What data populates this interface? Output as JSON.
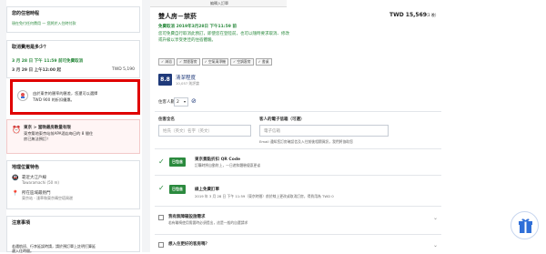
{
  "sidebar": {
    "your_stay": "您的住宿時程",
    "no_prepay": "現在免付任何費用 — 您將於入住時付款",
    "cancel_title": "取消費用是多少？",
    "cancel_free": "3 月 28 日 下午 11:59 前可免費取消",
    "cancel_after": "3 月 29 日 上午12:00 起",
    "cancel_fee": "TWD 5,190",
    "info_text_line1": "由於東京的匯率的匯差，您還可以選擇",
    "info_text_line2": "TWD 900 的折扣優惠。",
    "demand_title": "東京 > 當晚最房數量有限",
    "demand_text_line1": "東京築地東京站前APA酒店每日的 8 間住",
    "demand_text_line2": "房已無法預訂！",
    "location_title": "地理位置特色",
    "loc1_label": "靠近大江戶線",
    "loc1_sub": "Tawaramachi (50 m)",
    "loc2_label": "所在區域最熱門",
    "loc2_sub": "東京站 - 淺草和東京晴空塔周邊",
    "notes_title": "注意事項",
    "notes_text_line1": "若遇航班、行李延誤時請，請於預訂單上註明打算延",
    "notes_text_line2": "遲入住時間。"
  },
  "main": {
    "tab_label": "編輯入訂單",
    "room_title": "雙人房－禁菸",
    "price": "TWD 15,569",
    "nights": "（3 晚）",
    "free_cancel_line": "免費取消 2019年3月28日 下午11:59 前",
    "promo_line1": "您可免費自行取消此預訂，即使您在登陸前，也可以隨時要求取消、修改",
    "promo_line2": "或升級以享受更佳的住宿體驗。",
    "amenities": [
      "✓ 淋浴",
      "✓ 禁煙客房",
      "✓ 空氣清淨機",
      "✓ 空調客房",
      "✓ 書桌"
    ],
    "score": "8.8",
    "score_label": "清潔程度",
    "score_sub": "10,057 則評論",
    "guests_label": "住客人數：",
    "guests_value": "2",
    "name_label": "住客全名",
    "name_placeholder": "姓氏（英文）名字（英文）",
    "email_label": "客人的電子信箱（可選）",
    "email_placeholder": "電子信箱",
    "email_hint": "Email 通知您訂房確認信及入住前後相關資訊，我們將協助您",
    "qr_badge": "已包含",
    "qr_title": "東京景點折扣 QR Code",
    "qr_sub": "訂購時將自動附上，一日遊和體驗優惠更省",
    "early_badge": "已包含",
    "early_title": "線上免費訂單",
    "early_sub": "2019 年 3 月 28 日 下午 11:59（東京時間）前於線上更改或取消訂房，得費用為 TWD 0",
    "extra1_title": "我有無障礙設施需求",
    "extra1_sub": "若有輪椅使用需要時必須提出，這是一般的自選請求",
    "extra2_title": "想入住更好的客房嗎？"
  },
  "colors": {
    "accent_green": "#2b8a3e",
    "red_highlight": "#e00000",
    "score_blue": "#1f3a7a"
  }
}
